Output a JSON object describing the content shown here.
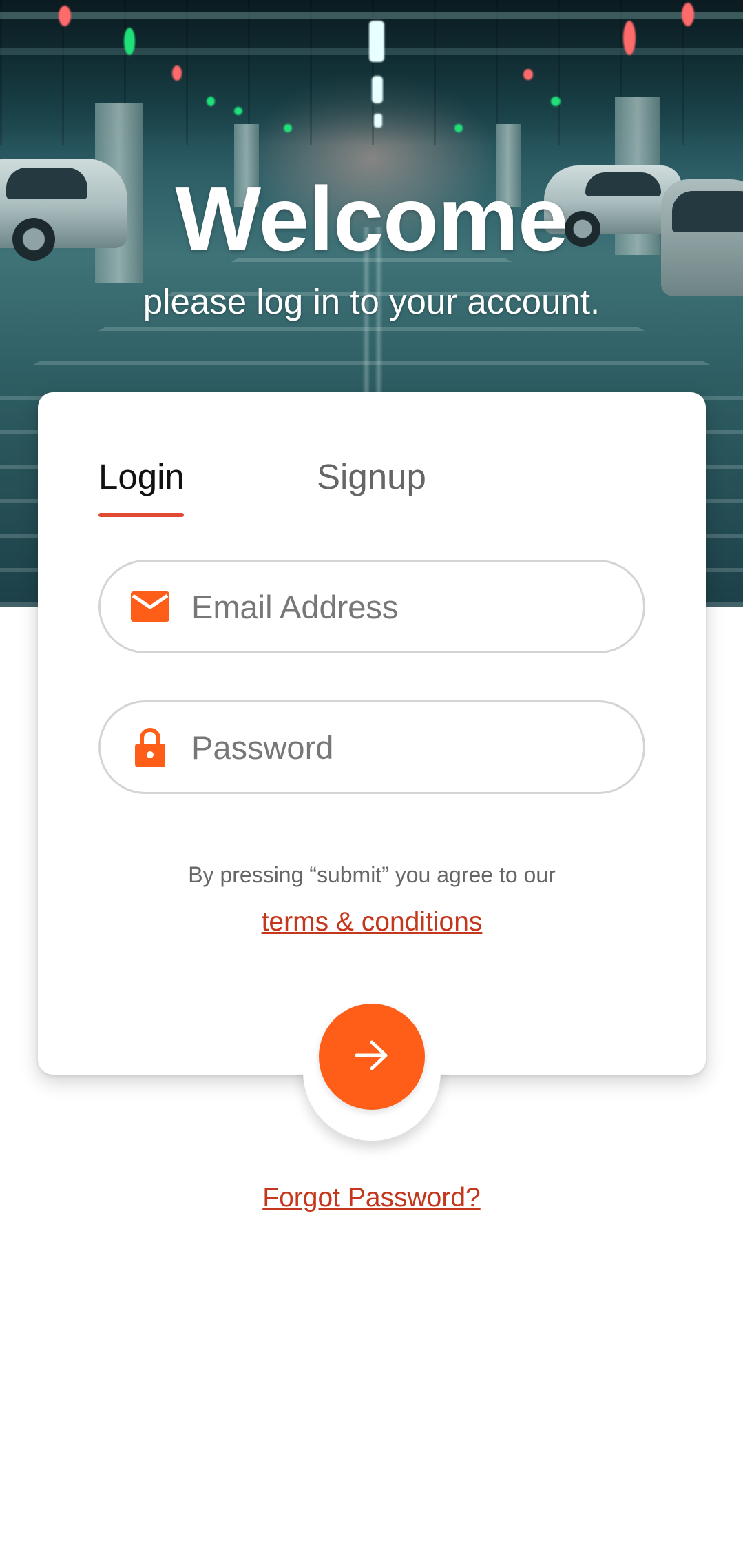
{
  "hero": {
    "title": "Welcome",
    "subtitle": "please log in to your account."
  },
  "tabs": {
    "login_label": "Login",
    "signup_label": "Signup",
    "active": "Login"
  },
  "form": {
    "email": {
      "placeholder": "Email Address",
      "value": "",
      "icon": "envelope-icon"
    },
    "password": {
      "placeholder": "Password",
      "value": "",
      "icon": "lock-icon"
    },
    "agree_text": "By pressing “submit” you agree to our",
    "terms_link": "terms & conditions",
    "submit_icon": "arrow-right-icon"
  },
  "forgot_password": "Forgot Password?",
  "colors": {
    "accent": "#ff5e19",
    "link": "#c4371c",
    "tab_indicator": "#e04a32",
    "field_border": "#d4d4d4"
  }
}
